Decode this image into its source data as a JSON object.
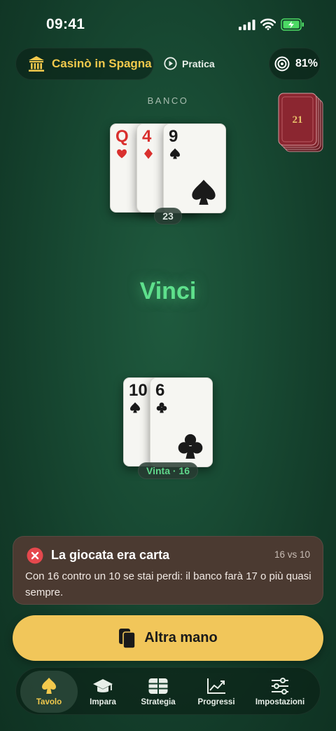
{
  "status_bar": {
    "time": "09:41"
  },
  "header": {
    "venue": "Casinò in Spagna",
    "mode": "Pratica",
    "accuracy": "81%"
  },
  "dealer": {
    "label": "BANCO",
    "score": "23",
    "cards": [
      {
        "rank": "Q",
        "suit": "hearts"
      },
      {
        "rank": "4",
        "suit": "diamonds"
      },
      {
        "rank": "9",
        "suit": "spades"
      }
    ]
  },
  "shoe": {
    "label": "21"
  },
  "result": "Vinci",
  "player": {
    "score": "Vinta · 16",
    "cards": [
      {
        "rank": "10",
        "suit": "spades"
      },
      {
        "rank": "6",
        "suit": "clubs"
      }
    ]
  },
  "feedback": {
    "title": "La giocata era carta",
    "tag": "16 vs 10",
    "body": "Con 16 contro un 10 se stai perdi: il banco farà 17 o più quasi sempre."
  },
  "next_button": "Altra mano",
  "tabs": [
    {
      "label": "Tavolo",
      "icon": "spade-icon",
      "active": true
    },
    {
      "label": "Impara",
      "icon": "graduation-cap-icon",
      "active": false
    },
    {
      "label": "Strategia",
      "icon": "grid-table-icon",
      "active": false
    },
    {
      "label": "Progressi",
      "icon": "chart-line-icon",
      "active": false
    },
    {
      "label": "Impostazioni",
      "icon": "sliders-icon",
      "active": false
    }
  ],
  "colors": {
    "felt": "#184a33",
    "accent_gold": "#f2c94c",
    "win_green": "#5ee08c",
    "error_red": "#e5484d",
    "feedback_bg": "#4b3a31"
  }
}
